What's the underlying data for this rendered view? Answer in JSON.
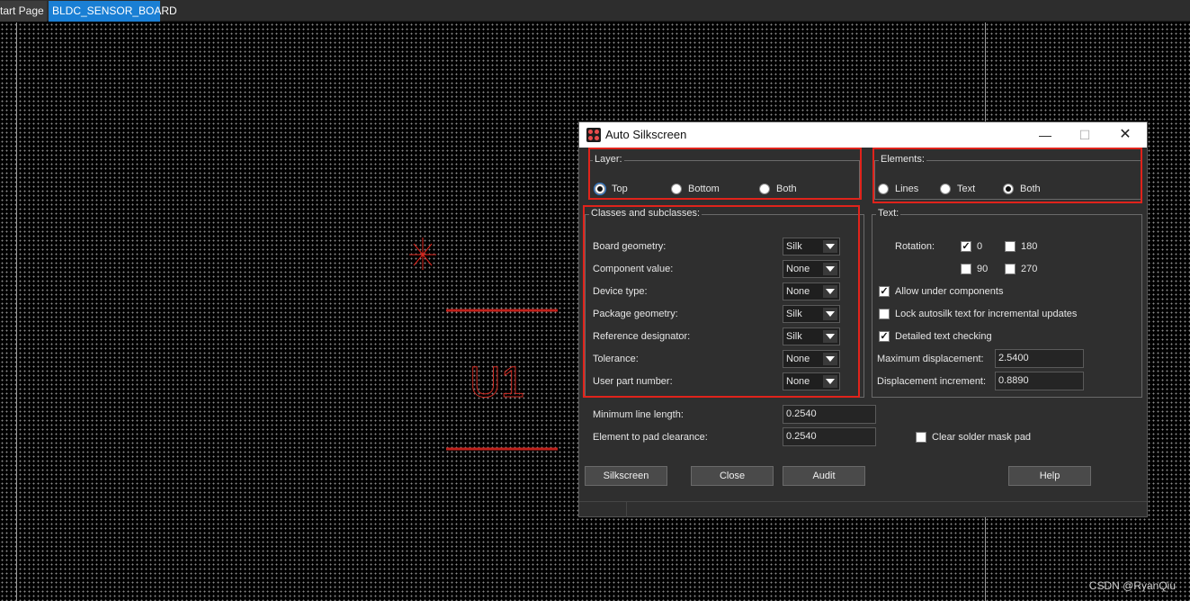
{
  "tabs": [
    {
      "label": "tart Page"
    },
    {
      "label": "BLDC_SENSOR_BOARD"
    }
  ],
  "canvas": {
    "designator_text": "U1",
    "watermark": "CSDN @RyanQiu",
    "colors": {
      "silk": "#e0231b",
      "grid": "#8a8a8a",
      "background": "#000000"
    }
  },
  "dialog": {
    "title": "Auto Silkscreen",
    "layer": {
      "label": "Layer:",
      "options": [
        "Top",
        "Bottom",
        "Both"
      ],
      "selected": "Top"
    },
    "elements": {
      "label": "Elements:",
      "options": [
        "Lines",
        "Text",
        "Both"
      ],
      "selected": "Both"
    },
    "classes": {
      "label": "Classes and subclasses:",
      "rows": [
        {
          "label": "Board geometry:",
          "value": "Silk"
        },
        {
          "label": "Component value:",
          "value": "None"
        },
        {
          "label": "Device type:",
          "value": "None"
        },
        {
          "label": "Package geometry:",
          "value": "Silk"
        },
        {
          "label": "Reference designator:",
          "value": "Silk"
        },
        {
          "label": "Tolerance:",
          "value": "None"
        },
        {
          "label": "User part number:",
          "value": "None"
        }
      ]
    },
    "text": {
      "label": "Text:",
      "rotation_label": "Rotation:",
      "rotations": [
        {
          "label": "0",
          "checked": true
        },
        {
          "label": "180",
          "checked": false
        },
        {
          "label": "90",
          "checked": false
        },
        {
          "label": "270",
          "checked": false
        }
      ],
      "allow_under": {
        "label": "Allow under components",
        "checked": true
      },
      "lock_autosilk": {
        "label": "Lock autosilk text for incremental updates",
        "checked": false
      },
      "detailed_check": {
        "label": "Detailed text checking",
        "checked": true
      },
      "max_disp_label": "Maximum displacement:",
      "max_disp_value": "2.5400",
      "disp_inc_label": "Displacement increment:",
      "disp_inc_value": "0.8890"
    },
    "min_line_label": "Minimum line length:",
    "min_line_value": "0.2540",
    "pad_clear_label": "Element to pad clearance:",
    "pad_clear_value": "0.2540",
    "clear_solder": {
      "label": "Clear solder mask pad",
      "checked": false
    },
    "buttons": {
      "silkscreen": "Silkscreen",
      "close": "Close",
      "audit": "Audit",
      "help": "Help"
    }
  }
}
